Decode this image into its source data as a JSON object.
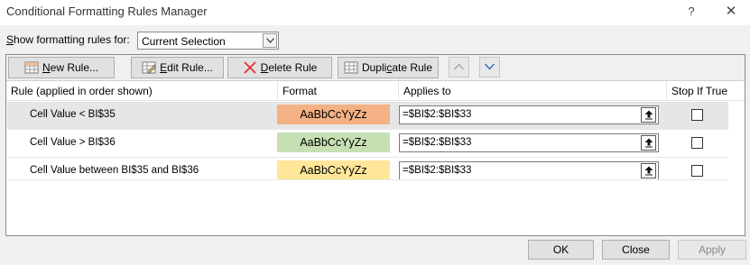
{
  "window": {
    "title": "Conditional Formatting Rules Manager",
    "help_icon": "?",
    "close_icon": "✕"
  },
  "show_rules": {
    "label_mnemonic": "S",
    "label_rest": "how formatting rules for:",
    "selected": "Current Selection"
  },
  "toolbar": {
    "new_rule_mn": "N",
    "new_rule_rest": "ew Rule...",
    "edit_rule_mn": "E",
    "edit_rule_rest": "dit Rule...",
    "delete_rule_mn": "D",
    "delete_rule_rest": "elete Rule",
    "duplicate_pre": "Dupli",
    "duplicate_mn": "c",
    "duplicate_post": "ate Rule",
    "icons": [
      "new-rule-icon",
      "edit-rule-icon",
      "delete-rule-icon",
      "duplicate-rule-icon",
      "move-up-icon",
      "move-down-icon"
    ]
  },
  "columns": {
    "rule": "Rule (applied in order shown)",
    "format": "Format",
    "applies_to": "Applies to",
    "stop_if_true": "Stop If True"
  },
  "rules": [
    {
      "rule": "Cell Value < BI$35",
      "format_preview": "AaBbCcYyZz",
      "fill": "#f4b183",
      "applies_to": "=$BI$2:$BI$33",
      "stop_if_true": false,
      "selected": true
    },
    {
      "rule": "Cell Value > BI$36",
      "format_preview": "AaBbCcYyZz",
      "fill": "#c6e0b4",
      "applies_to": "=$BI$2:$BI$33",
      "stop_if_true": false,
      "selected": false
    },
    {
      "rule": "Cell Value between BI$35 and BI$36",
      "format_preview": "AaBbCcYyZz",
      "fill": "#ffe699",
      "applies_to": "=$BI$2:$BI$33",
      "stop_if_true": false,
      "selected": false
    }
  ],
  "footer": {
    "ok": "OK",
    "close": "Close",
    "apply": "Apply"
  }
}
